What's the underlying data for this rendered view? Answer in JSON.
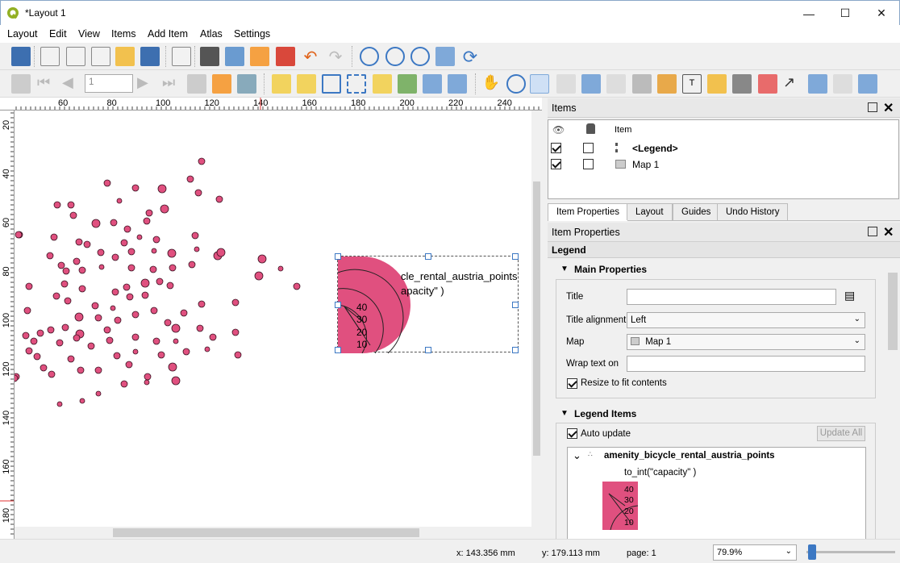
{
  "window": {
    "title": "*Layout 1",
    "minimize_glyph": "—",
    "maximize_glyph": "☐",
    "close_glyph": "✕"
  },
  "menu": [
    "Layout",
    "Edit",
    "View",
    "Items",
    "Add Item",
    "Atlas",
    "Settings"
  ],
  "nav_toolbar": {
    "page_value": "1"
  },
  "ruler_h_ticks": [
    "60",
    "80",
    "100",
    "120",
    "140",
    "160",
    "180",
    "200",
    "220",
    "240"
  ],
  "ruler_v_ticks": [
    "20",
    "40",
    "60",
    "80",
    "100",
    "120",
    "140",
    "160",
    "180"
  ],
  "canvas_legend": {
    "layer_text": "cle_rental_austria_points",
    "expr_text": "apacity\" )",
    "sizes": [
      "40",
      "30",
      "20",
      "10"
    ],
    "symbol_color": "#e0507f"
  },
  "items_panel": {
    "title": "Items",
    "column_item": "Item",
    "rows": [
      {
        "label": "<Legend>",
        "visible": true,
        "locked": false
      },
      {
        "label": "Map 1",
        "visible": true,
        "locked": false
      }
    ]
  },
  "tabs": [
    "Item Properties",
    "Layout",
    "Guides",
    "Undo History"
  ],
  "props_panel": {
    "title": "Item Properties",
    "item_type": "Legend",
    "main_section": "Main Properties",
    "title_label": "Title",
    "title_value": "",
    "title_align_label": "Title alignment",
    "title_align_value": "Left",
    "map_label": "Map",
    "map_value": "Map 1",
    "wrap_label": "Wrap text on",
    "wrap_value": "",
    "resize_label": "Resize to fit contents",
    "legend_section": "Legend Items",
    "auto_update_label": "Auto update",
    "update_all_label": "Update All",
    "tree_layer": "amenity_bicycle_rental_austria_points",
    "tree_expr": "to_int(\"capacity\" )",
    "tree_sizes": [
      "40",
      "30",
      "20",
      "10"
    ]
  },
  "status": {
    "x": "x: 143.356 mm",
    "y": "y: 179.113 mm",
    "page": "page: 1",
    "zoom": "79.9%"
  },
  "colors": {
    "accent": "#3c78c3",
    "point": "#e0507f"
  }
}
